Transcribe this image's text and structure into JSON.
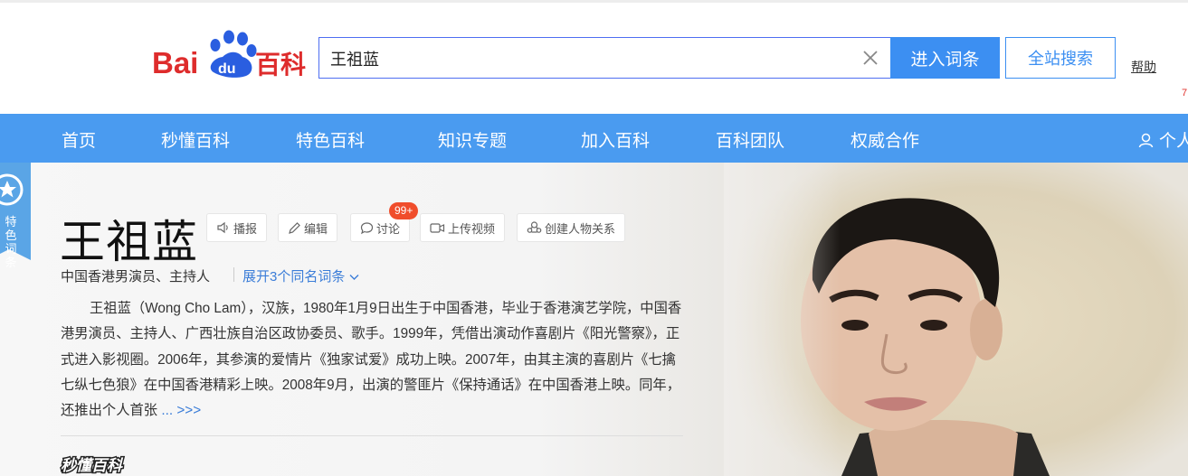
{
  "logo": {
    "text": "Bai百科"
  },
  "search": {
    "value": "王祖蓝",
    "enter_label": "进入词条",
    "site_label": "全站搜索"
  },
  "header": {
    "help_label": "帮助"
  },
  "nav": {
    "items": [
      "首页",
      "秒懂百科",
      "特色百科",
      "知识专题",
      "加入百科",
      "百科团队",
      "权威合作"
    ],
    "user_label": "个人"
  },
  "entry": {
    "badge_label": "特色词条",
    "title": "王祖蓝",
    "tools": [
      {
        "label": "播报",
        "icon": "speaker-icon"
      },
      {
        "label": "编辑",
        "icon": "pencil-icon"
      },
      {
        "label": "讨论",
        "icon": "chat-bubble-icon"
      },
      {
        "label": "上传视频",
        "icon": "video-icon"
      },
      {
        "label": "创建人物关系",
        "icon": "people-relation-icon"
      }
    ],
    "discussion_count": "99+",
    "subtitle": "中国香港男演员、主持人",
    "same_name_label": "展开3个同名词条",
    "summary": "王祖蓝（Wong Cho Lam），汉族，1980年1月9日出生于中国香港，毕业于香港演艺学院，中国香港男演员、主持人、广西壮族自治区政协委员、歌手。1999年，凭借出演动作喜剧片《阳光警察》，正式进入影视圈。2006年，其参演的爱情片《独家试爱》成功上映。2007年，由其主演的喜剧片《七擒七纵七色狼》在中国香港精彩上映。2008年9月，出演的警匪片《保持通话》在中国香港上映。同年，还推出个人首张",
    "more_label": "... >>>",
    "miaodong_label": "秒懂百科"
  },
  "colors": {
    "brand_red": "#de2c2c",
    "brand_blue": "#2a5ee0",
    "nav_blue": "#4a9bf0",
    "button_blue": "#3c8ff2",
    "badge_red": "#f04d2b"
  }
}
